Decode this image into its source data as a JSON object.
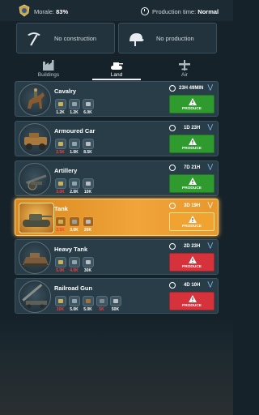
{
  "topbar": {
    "morale_label": "Morale:",
    "morale_value": "83%",
    "production_time_label": "Production time:",
    "production_time_value": "Normal"
  },
  "slots": {
    "construction": "No construction",
    "production": "No production"
  },
  "tabs": [
    {
      "label": "Buildings",
      "active": false
    },
    {
      "label": "Land",
      "active": true
    },
    {
      "label": "Air",
      "active": false
    }
  ],
  "units": [
    {
      "name": "Cavalry",
      "time": "23H 49MIN",
      "resources": [
        {
          "value": "1.2K",
          "red": false,
          "color": "#c9b15a"
        },
        {
          "value": "1.2K",
          "red": false,
          "color": "#8fa4ac"
        },
        {
          "value": "6.0K",
          "red": false,
          "color": "#b6bfc4"
        }
      ],
      "button": {
        "label": "PRODUCE",
        "style": "green"
      }
    },
    {
      "name": "Armoured Car",
      "time": "1D 23H",
      "resources": [
        {
          "value": "2.5K",
          "red": true,
          "color": "#c9b15a"
        },
        {
          "value": "1.0K",
          "red": false,
          "color": "#8fa4ac"
        },
        {
          "value": "8.5K",
          "red": false,
          "color": "#b6bfc4"
        }
      ],
      "button": {
        "label": "PRODUCE",
        "style": "green"
      }
    },
    {
      "name": "Artillery",
      "time": "7D 21H",
      "resources": [
        {
          "value": "3.0K",
          "red": true,
          "color": "#c9b15a"
        },
        {
          "value": "2.0K",
          "red": false,
          "color": "#8fa4ac"
        },
        {
          "value": "10K",
          "red": false,
          "color": "#b6bfc4"
        }
      ],
      "button": {
        "label": "PRODUCE",
        "style": "green"
      }
    },
    {
      "name": "Tank",
      "time": "3D 19H",
      "resources": [
        {
          "value": "3.5K",
          "red": true,
          "color": "#c9b15a"
        },
        {
          "value": "3.0K",
          "red": false,
          "color": "#8fa4ac"
        },
        {
          "value": "20K",
          "red": false,
          "color": "#b6bfc4"
        }
      ],
      "button": {
        "label": "PRODUCE",
        "style": "orange"
      }
    },
    {
      "name": "Heavy Tank",
      "time": "2D 23H",
      "resources": [
        {
          "value": "5.0K",
          "red": true,
          "color": "#c9b15a"
        },
        {
          "value": "4.0K",
          "red": true,
          "color": "#8fa4ac"
        },
        {
          "value": "30K",
          "red": false,
          "color": "#b6bfc4"
        }
      ],
      "button": {
        "label": "PRODUCE",
        "style": "red"
      }
    },
    {
      "name": "Railroad Gun",
      "time": "4D 10H",
      "resources": [
        {
          "value": "10K",
          "red": true,
          "color": "#c9b15a"
        },
        {
          "value": "5.0K",
          "red": false,
          "color": "#8fa4ac"
        },
        {
          "value": "5.0K",
          "red": false,
          "color": "#a0743d"
        },
        {
          "value": "5K",
          "red": true,
          "color": "#7d8a90"
        },
        {
          "value": "50K",
          "red": false,
          "color": "#b6bfc4"
        }
      ],
      "button": {
        "label": "PRODUCE",
        "style": "red"
      }
    }
  ],
  "icons": {
    "morale": "medal-badge-icon",
    "clock": "clock-icon",
    "construction": "pickaxe-icon",
    "production": "helmet-icon",
    "buildings_tab": "factory-icon",
    "land_tab": "tank-icon",
    "air_tab": "plane-icon",
    "warning": "warning-triangle-icon",
    "expand": "chevron-double-down-icon"
  }
}
